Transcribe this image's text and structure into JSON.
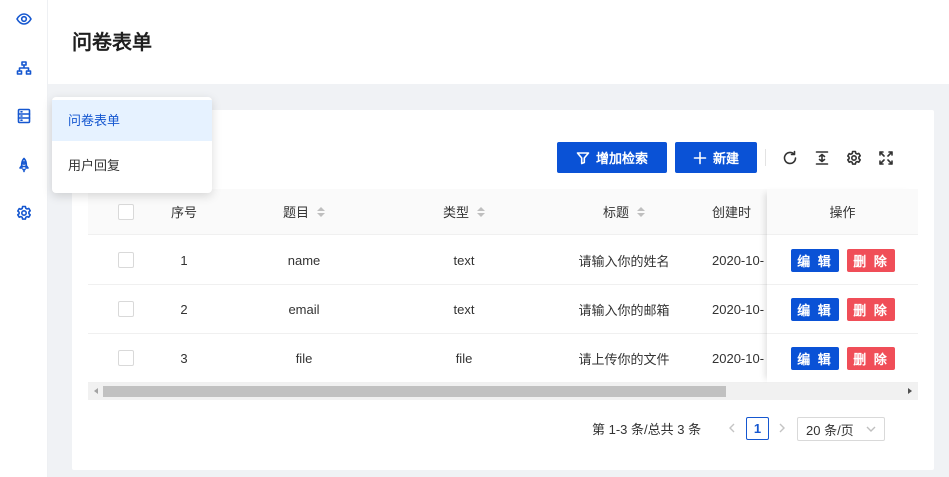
{
  "header": {
    "title": "问卷表单"
  },
  "rail": {
    "icons": [
      "eye-icon",
      "sitemap-icon",
      "database-icon",
      "rocket-icon",
      "settings-icon"
    ]
  },
  "popup": {
    "items": [
      {
        "label": "问卷表单",
        "active": true
      },
      {
        "label": "用户回复",
        "active": false
      }
    ]
  },
  "toolbar": {
    "add_search_label": "增加检索",
    "new_label": "新建",
    "icons": [
      "reload-icon",
      "column-height-icon",
      "settings-icon",
      "fullscreen-icon"
    ]
  },
  "table": {
    "columns": {
      "index": "序号",
      "question": "题目",
      "type": "类型",
      "title": "标题",
      "created": "创建时",
      "actions": "操作"
    },
    "rows": [
      {
        "index": "1",
        "question": "name",
        "type": "text",
        "title": "请输入你的姓名",
        "created": "2020-10-"
      },
      {
        "index": "2",
        "question": "email",
        "type": "text",
        "title": "请输入你的邮箱",
        "created": "2020-10-"
      },
      {
        "index": "3",
        "question": "file",
        "type": "file",
        "title": "请上传你的文件",
        "created": "2020-10-"
      }
    ],
    "edit_label": "编 辑",
    "delete_label": "删 除"
  },
  "pagination": {
    "total_text": "第 1-3 条/总共 3 条",
    "current_page": "1",
    "page_size": "20 条/页"
  },
  "colors": {
    "primary": "#0a52d6",
    "danger": "#f04e58",
    "menu_active_bg": "#e6f2ff"
  }
}
